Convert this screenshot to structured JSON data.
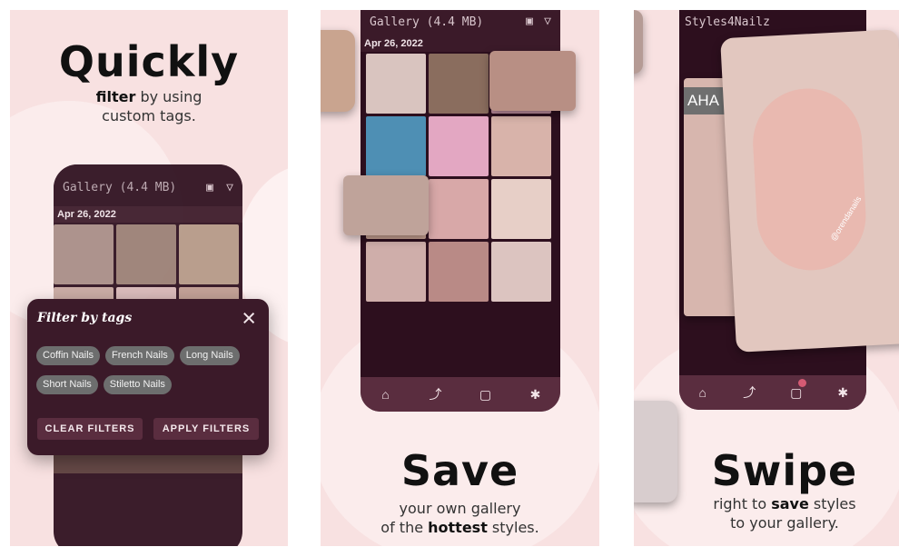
{
  "panels": [
    {
      "headline": "Quickly",
      "subtitle_line1_strong": "filter",
      "subtitle_line1_rest": " by using",
      "subtitle_line2": "custom tags.",
      "gallery_title": "Gallery (4.4 MB)",
      "date": "Apr 26, 2022",
      "dialog": {
        "title": "Filter by tags",
        "close_icon": "×",
        "chips": [
          "Coffin Nails",
          "French Nails",
          "Long Nails",
          "Short Nails",
          "Stiletto Nails"
        ],
        "clear_label": "CLEAR FILTERS",
        "apply_label": "APPLY FILTERS"
      }
    },
    {
      "headline": "Save",
      "subtitle_line1": "your own gallery",
      "subtitle_line2_prefix": "of the ",
      "subtitle_line2_strong": "hottest",
      "subtitle_line2_suffix": " styles.",
      "gallery_title": "Gallery (4.4 MB)",
      "date": "Apr 26, 2022"
    },
    {
      "headline": "Swipe",
      "subtitle_line1_prefix": "right to ",
      "subtitle_line1_strong": "save",
      "subtitle_line1_suffix": " styles",
      "subtitle_line2": "to your gallery.",
      "profile_title": "Styles4Nailz",
      "photo_caption": "AHA",
      "watermark": "@orendanails"
    }
  ],
  "icons": {
    "home": "⌂",
    "trend": "⤴",
    "saved": "▢",
    "settings": "✱",
    "select": "▣",
    "filter": "▽"
  },
  "colors": {
    "background": "#f8e1e1",
    "app_dark": "#2d0f1e",
    "app_bar": "#3b1a29",
    "accent": "#5a2d3f",
    "chip": "#6d6e6e"
  }
}
